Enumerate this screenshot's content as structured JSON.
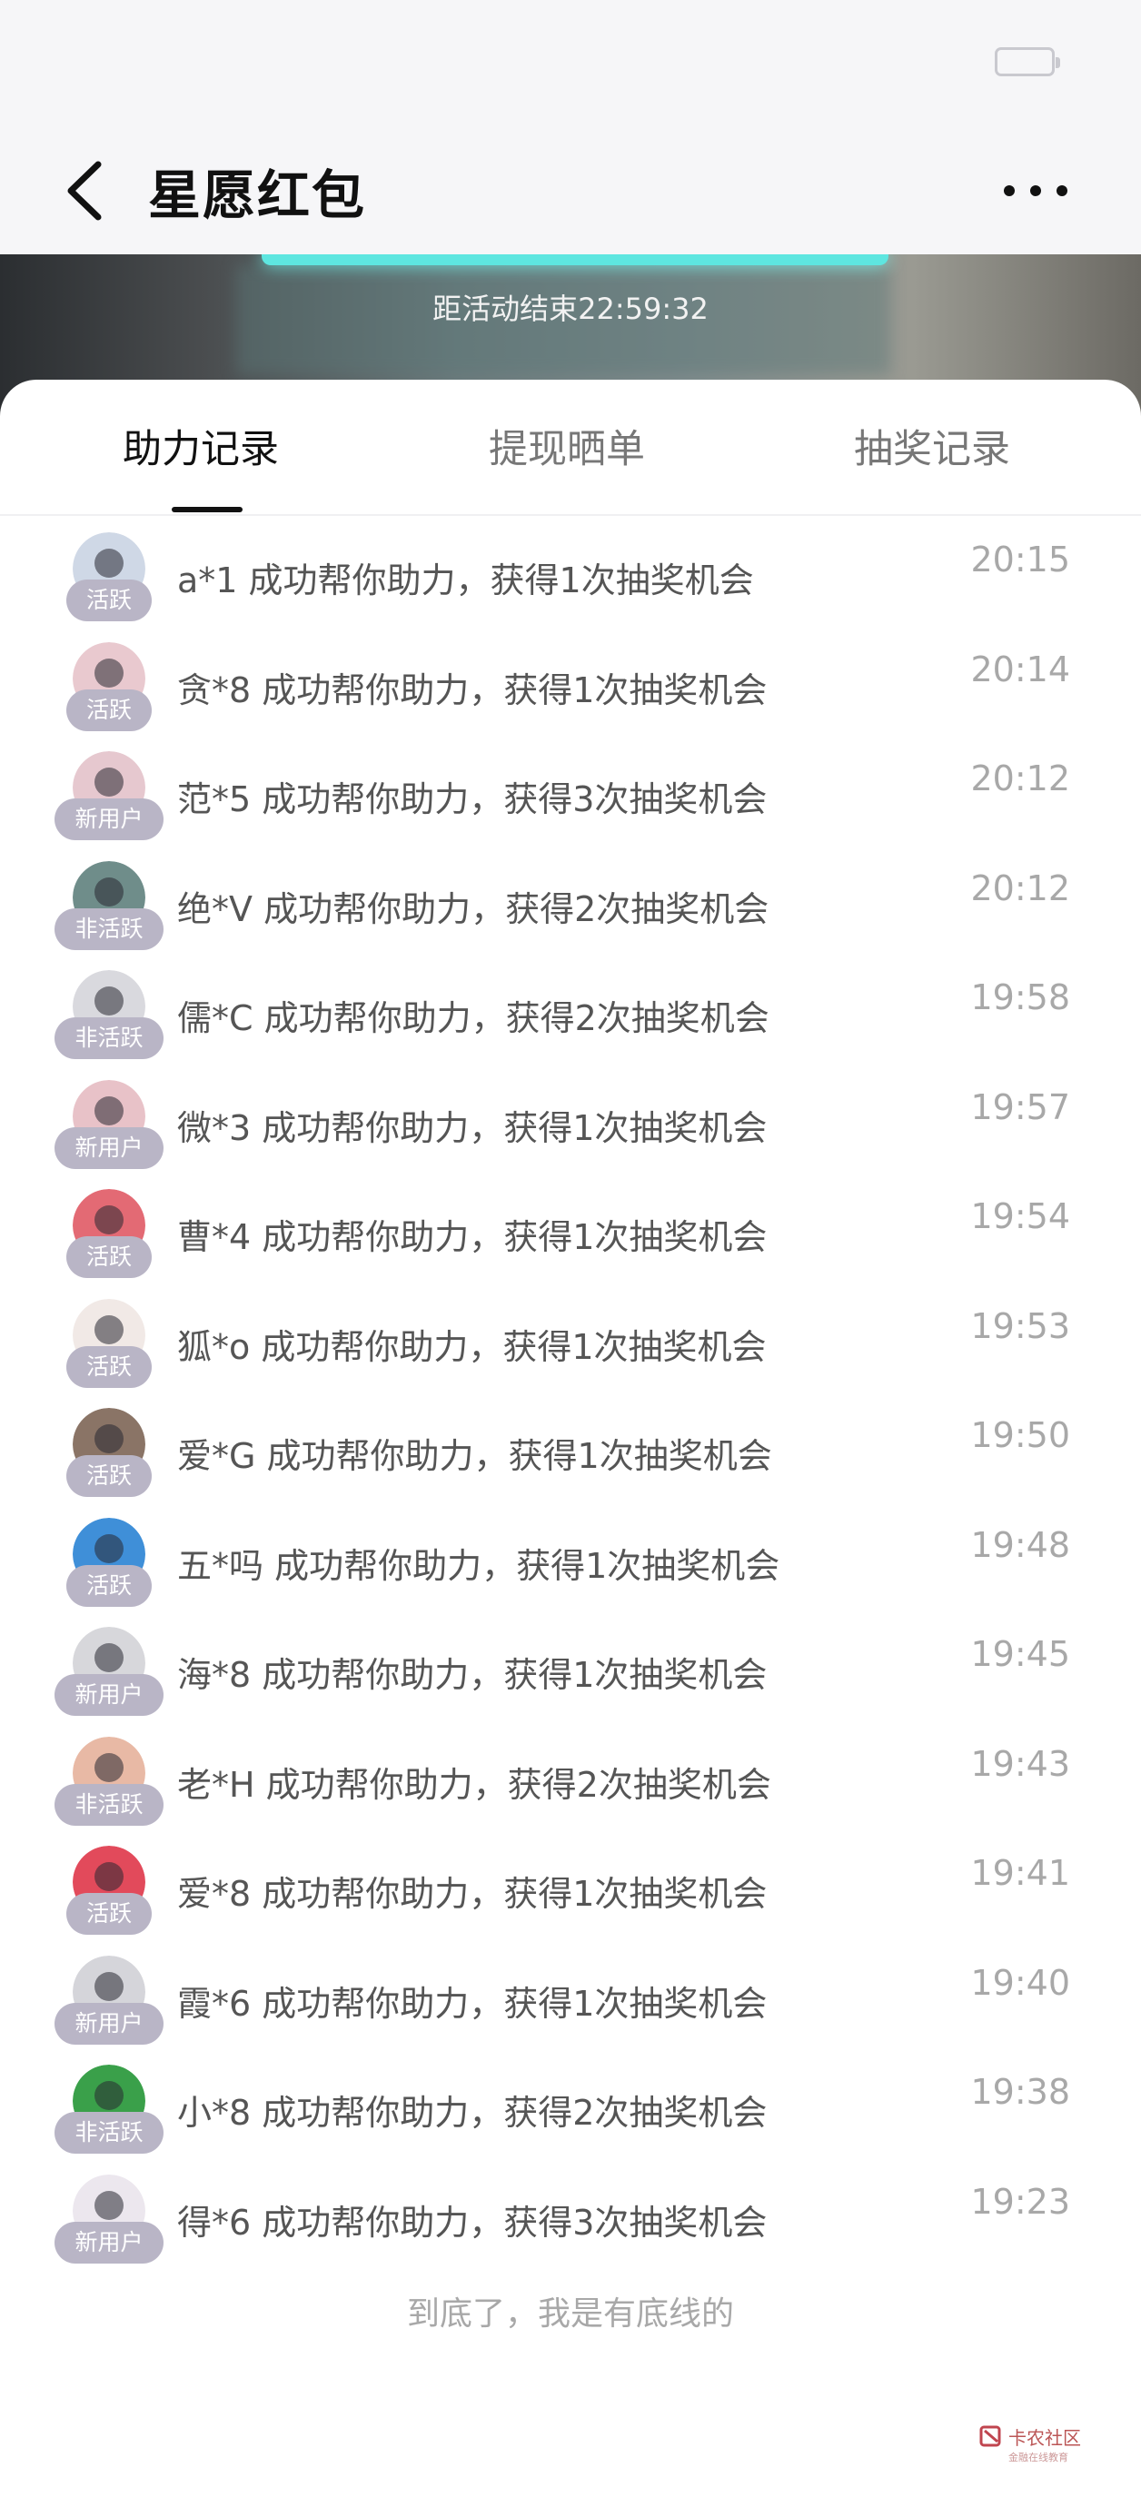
{
  "header": {
    "title": "星愿红包"
  },
  "banner": {
    "countdown": "距活动结束22:59:32"
  },
  "tabs": [
    {
      "label": "助力记录",
      "active": true
    },
    {
      "label": "提现晒单",
      "active": false
    },
    {
      "label": "抽奖记录",
      "active": false
    }
  ],
  "records": [
    {
      "badge": "活跃",
      "message": "a*1 成功帮你助力，获得1次抽奖机会",
      "time": "20:15",
      "avatar_color": "#cfd8e6"
    },
    {
      "badge": "活跃",
      "message": "贪*8 成功帮你助力，获得1次抽奖机会",
      "time": "20:14",
      "avatar_color": "#e9c9cf"
    },
    {
      "badge": "新用户",
      "message": "范*5 成功帮你助力，获得3次抽奖机会",
      "time": "20:12",
      "avatar_color": "#e6c8cf"
    },
    {
      "badge": "非活跃",
      "message": "绝*V 成功帮你助力，获得2次抽奖机会",
      "time": "20:12",
      "avatar_color": "#6f8d8a"
    },
    {
      "badge": "非活跃",
      "message": "儒*C 成功帮你助力，获得2次抽奖机会",
      "time": "19:58",
      "avatar_color": "#d9d9de"
    },
    {
      "badge": "新用户",
      "message": "微*3 成功帮你助力，获得1次抽奖机会",
      "time": "19:57",
      "avatar_color": "#e8c2c8"
    },
    {
      "badge": "活跃",
      "message": "曹*4 成功帮你助力，获得1次抽奖机会",
      "time": "19:54",
      "avatar_color": "#e36a74"
    },
    {
      "badge": "活跃",
      "message": "狐*o 成功帮你助力，获得1次抽奖机会",
      "time": "19:53",
      "avatar_color": "#f1e9e6"
    },
    {
      "badge": "活跃",
      "message": "爱*G 成功帮你助力，获得1次抽奖机会",
      "time": "19:50",
      "avatar_color": "#8a7466"
    },
    {
      "badge": "活跃",
      "message": "五*吗 成功帮你助力，获得1次抽奖机会",
      "time": "19:48",
      "avatar_color": "#3f8fd8"
    },
    {
      "badge": "新用户",
      "message": "海*8 成功帮你助力，获得1次抽奖机会",
      "time": "19:45",
      "avatar_color": "#d7d7db"
    },
    {
      "badge": "非活跃",
      "message": "老*H 成功帮你助力，获得2次抽奖机会",
      "time": "19:43",
      "avatar_color": "#e8b9a5"
    },
    {
      "badge": "活跃",
      "message": "爱*8 成功帮你助力，获得1次抽奖机会",
      "time": "19:41",
      "avatar_color": "#e24a5b"
    },
    {
      "badge": "新用户",
      "message": "霞*6 成功帮你助力，获得1次抽奖机会",
      "time": "19:40",
      "avatar_color": "#d5d5da"
    },
    {
      "badge": "非活跃",
      "message": "小*8 成功帮你助力，获得2次抽奖机会",
      "time": "19:38",
      "avatar_color": "#3aa04a"
    },
    {
      "badge": "新用户",
      "message": "得*6 成功帮你助力，获得3次抽奖机会",
      "time": "19:23",
      "avatar_color": "#ece7ee"
    }
  ],
  "footer": {
    "text": "到底了，我是有底线的"
  },
  "watermark": {
    "text": "卡农社区",
    "subtext": "金融在线教育"
  }
}
